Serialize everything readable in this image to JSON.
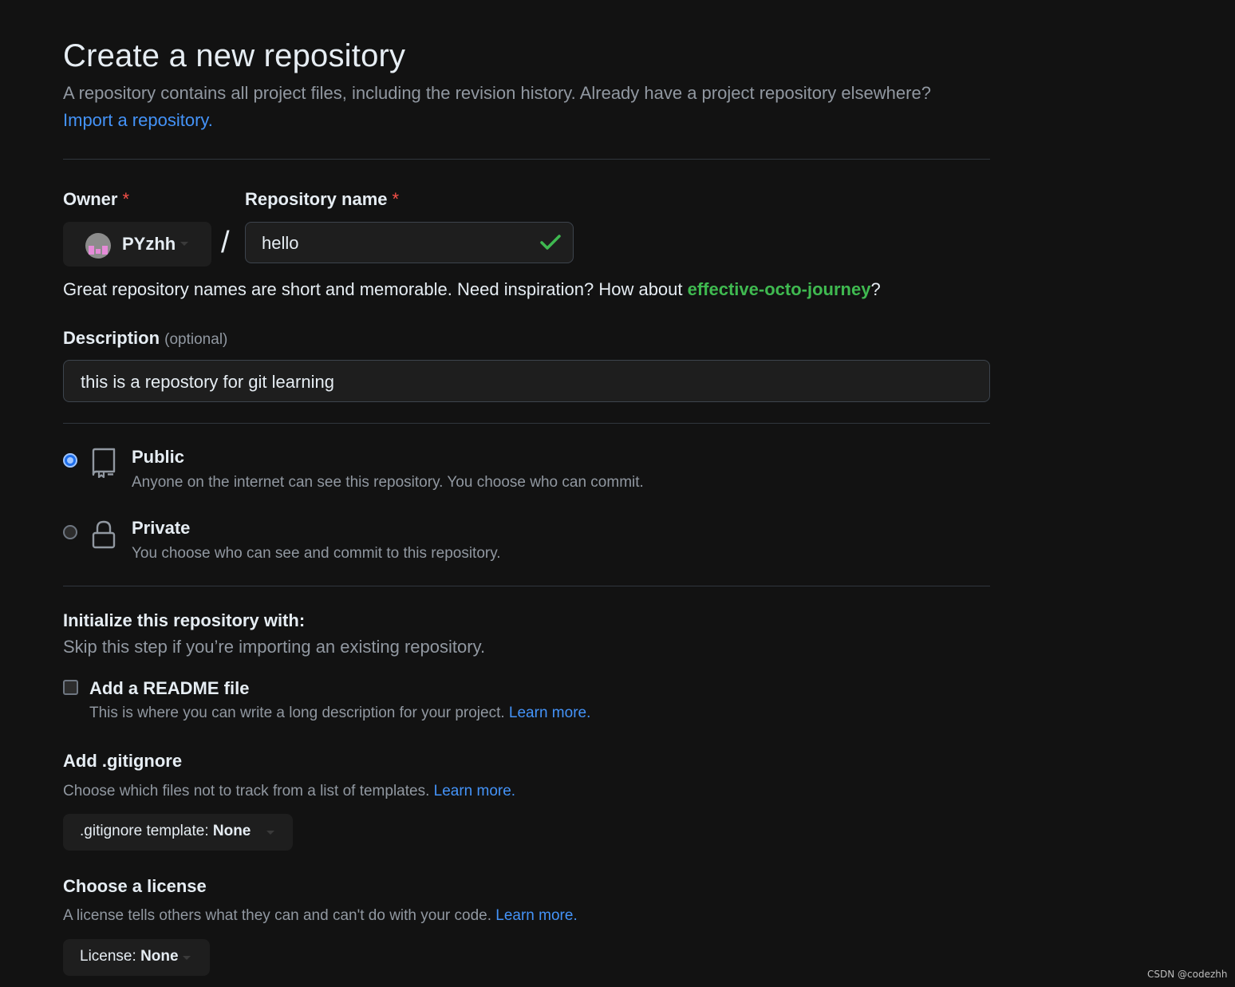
{
  "header": {
    "title": "Create a new repository",
    "subtitle": "A repository contains all project files, including the revision history. Already have a project repository elsewhere?",
    "import_link": "Import a repository."
  },
  "owner": {
    "label": "Owner",
    "required_mark": "*",
    "value": "PYzhh"
  },
  "separator": "/",
  "repo_name": {
    "label": "Repository name",
    "required_mark": "*",
    "value": "hello",
    "valid_icon": "check-icon"
  },
  "name_hint": {
    "text": "Great repository names are short and memorable. Need inspiration? How about ",
    "suggestion": "effective-octo-journey",
    "end": "?"
  },
  "description": {
    "label": "Description",
    "optional": "(optional)",
    "value": "this is a repostory for git learning"
  },
  "visibility": {
    "selected": "Public",
    "options": [
      {
        "title": "Public",
        "desc": "Anyone on the internet can see this repository. You choose who can commit.",
        "icon": "repo-icon"
      },
      {
        "title": "Private",
        "desc": "You choose who can see and commit to this repository.",
        "icon": "lock-icon"
      }
    ]
  },
  "initialize": {
    "heading": "Initialize this repository with:",
    "subheading": "Skip this step if you’re importing an existing repository.",
    "readme": {
      "label": "Add a README file",
      "checked": false,
      "desc": "This is where you can write a long description for your project.",
      "link": "Learn more."
    }
  },
  "gitignore": {
    "heading": "Add .gitignore",
    "desc": "Choose which files not to track from a list of templates.",
    "link": "Learn more.",
    "dropdown_label": ".gitignore template:",
    "dropdown_value": "None"
  },
  "license": {
    "heading": "Choose a license",
    "desc": "A license tells others what they can and can't do with your code.",
    "link": "Learn more.",
    "dropdown_label": "License:",
    "dropdown_value": "None"
  },
  "watermark": "CSDN @codezhh",
  "colors": {
    "background": "#121212",
    "link": "#4493f8",
    "success": "#3fb950",
    "required": "#f85149",
    "muted": "#9198a1"
  }
}
